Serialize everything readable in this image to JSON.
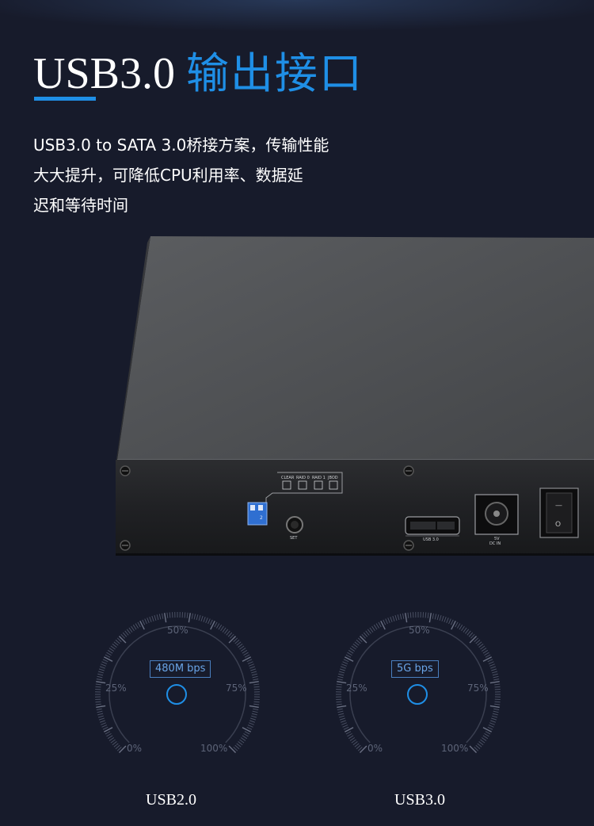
{
  "header": {
    "title_en": "USB3.0",
    "title_cn": "输出接口"
  },
  "description": {
    "lines": [
      "USB3.0 to SATA 3.0桥接方案，传输性能",
      "大大提升，可降低CPU利用率、数据延",
      "迟和等待时间"
    ]
  },
  "device": {
    "panel_labels": {
      "clear": "CLEAR",
      "raid0": "RAID 0",
      "raid1": "RAID 1",
      "jbod": "JBOD",
      "set": "SET",
      "usb": "USB 3.0",
      "power_line1": "5V",
      "power_line2": "DC IN",
      "switch_on": "—",
      "switch_off": "O"
    },
    "dip_switch_number": "2"
  },
  "gauges": [
    {
      "label": "USB2.0",
      "speed": "480M bps",
      "ticks": {
        "p0": "0%",
        "p25": "25%",
        "p50": "50%",
        "p75": "75%",
        "p100": "100%"
      }
    },
    {
      "label": "USB3.0",
      "speed": "5G bps",
      "ticks": {
        "p0": "0%",
        "p25": "25%",
        "p50": "50%",
        "p75": "75%",
        "p100": "100%"
      }
    }
  ],
  "colors": {
    "background": "#171b2b",
    "accent": "#1f8fe6"
  }
}
